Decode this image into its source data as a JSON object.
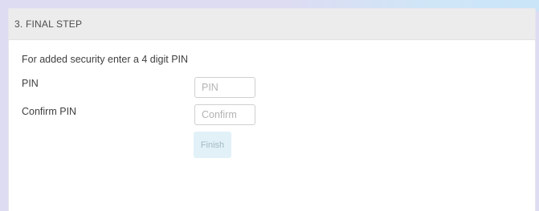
{
  "step": {
    "title": "3. FINAL STEP"
  },
  "form": {
    "intro": "For added security enter a 4 digit PIN",
    "pin": {
      "label": "PIN",
      "placeholder": "PIN",
      "value": ""
    },
    "confirm": {
      "label": "Confirm PIN",
      "placeholder": "Confirm",
      "value": ""
    },
    "finish": {
      "label": "Finish",
      "disabled": true
    }
  },
  "colors": {
    "page_background": "#dddcf3",
    "header_background": "#ececec",
    "finish_disabled_background": "#e2f1f8",
    "finish_disabled_text": "#a3b9c5"
  }
}
